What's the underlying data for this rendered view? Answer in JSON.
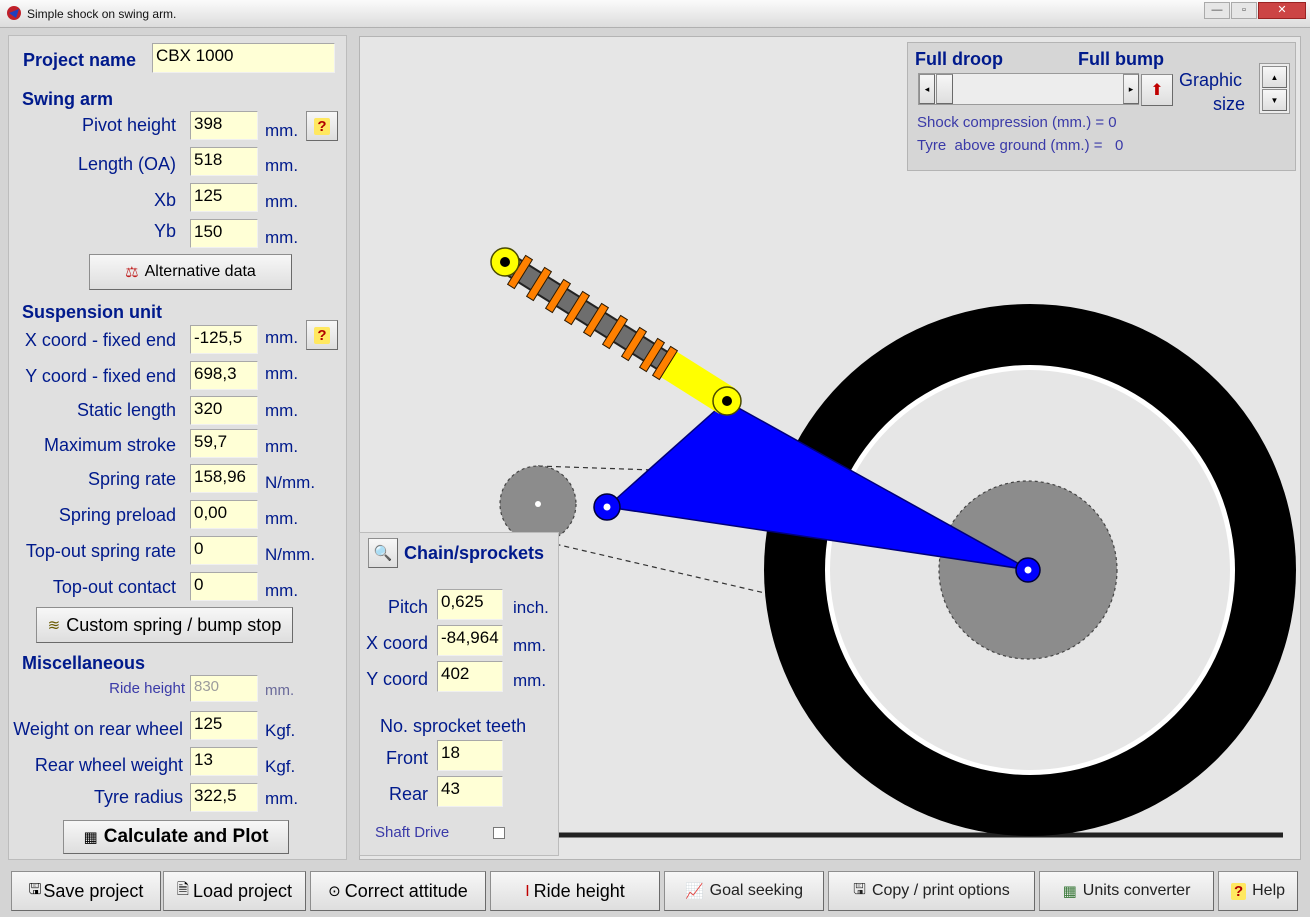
{
  "window": {
    "title": "Simple shock on swing arm."
  },
  "project": {
    "label": "Project name",
    "value": "CBX 1000"
  },
  "swing_arm": {
    "header": "Swing arm",
    "pivot_height": {
      "label": "Pivot height",
      "value": "398",
      "unit": "mm."
    },
    "length": {
      "label": "Length (OA)",
      "value": "518",
      "unit": "mm."
    },
    "xb": {
      "label": "Xb",
      "value": "125",
      "unit": "mm."
    },
    "yb": {
      "label": "Yb",
      "value": "150",
      "unit": "mm."
    },
    "alt_button": "Alternative data",
    "help": "?"
  },
  "suspension": {
    "header": "Suspension unit",
    "x_fixed": {
      "label": "X coord - fixed end",
      "value": "-125,5",
      "unit": "mm."
    },
    "y_fixed": {
      "label": "Y coord - fixed end",
      "value": "698,3",
      "unit": "mm."
    },
    "static_length": {
      "label": "Static length",
      "value": "320",
      "unit": "mm."
    },
    "max_stroke": {
      "label": "Maximum stroke",
      "value": "59,7",
      "unit": "mm."
    },
    "spring_rate": {
      "label": "Spring rate",
      "value": "158,96",
      "unit": "N/mm."
    },
    "preload": {
      "label": "Spring preload",
      "value": "0,00",
      "unit": "mm."
    },
    "topout_rate": {
      "label": "Top-out spring rate",
      "value": "0",
      "unit": "N/mm."
    },
    "topout_contact": {
      "label": "Top-out contact",
      "value": "0",
      "unit": "mm."
    },
    "custom_button": "Custom spring / bump stop",
    "help": "?"
  },
  "misc": {
    "header": "Miscellaneous",
    "ride_height": {
      "label": "Ride height",
      "value": "830",
      "unit": "mm."
    },
    "weight_rear": {
      "label": "Weight on rear wheel",
      "value": "125",
      "unit": "Kgf."
    },
    "wheel_weight": {
      "label": "Rear wheel weight",
      "value": "13",
      "unit": "Kgf."
    },
    "tyre_radius": {
      "label": "Tyre radius",
      "value": "322,5",
      "unit": "mm."
    },
    "calc_button": "Calculate and Plot"
  },
  "chain": {
    "header": "Chain/sprockets",
    "pitch": {
      "label": "Pitch",
      "value": "0,625",
      "unit": "inch."
    },
    "x": {
      "label": "X coord",
      "value": "-84,964",
      "unit": "mm."
    },
    "y": {
      "label": "Y coord",
      "value": "402",
      "unit": "mm."
    },
    "teeth_header": "No. sprocket teeth",
    "front": {
      "label": "Front",
      "value": "18"
    },
    "rear": {
      "label": "Rear",
      "value": "43"
    },
    "shaft_drive": "Shaft Drive",
    "shaft_drive_checked": false
  },
  "controls": {
    "full_droop": "Full droop",
    "full_bump": "Full bump",
    "graphic_size_1": "Graphic",
    "graphic_size_2": "size",
    "shock_compression": "Shock compression (mm.) = 0",
    "tyre_above": "Tyre  above ground (mm.) =   0",
    "slider_position": 0
  },
  "bottom": {
    "save": "Save project",
    "load": "Load project",
    "correct": "Correct attitude",
    "ride": "Ride height",
    "goal": "Goal seeking",
    "copy": "Copy / print options",
    "units": "Units converter",
    "help": "Help"
  },
  "colors": {
    "label_blue": "#001a8c",
    "field_yellow": "#ffffd6",
    "swingarm_blue": "#0000ff",
    "shock_yellow": "#ffff00",
    "spring_orange": "#ff8000",
    "sprocket_gray": "#8c8c8c",
    "tyre_black": "#000000"
  }
}
